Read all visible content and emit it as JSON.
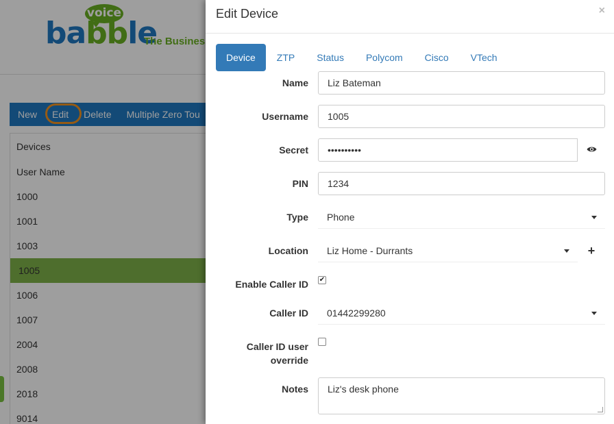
{
  "background": {
    "logo": {
      "bubble": "voice",
      "word_part1": "ba",
      "word_part2": "bb",
      "word_part3": "le",
      "tagline": "The Business"
    },
    "toolbar": {
      "new": "New",
      "edit": "Edit",
      "delete": "Delete",
      "multiple": "Multiple Zero Tou"
    },
    "panel": {
      "title": "Devices",
      "column": "User Name",
      "rows": [
        "1000",
        "1001",
        "1003",
        "1005",
        "1006",
        "1007",
        "2004",
        "2008",
        "2018",
        "9014"
      ],
      "selected_row": "1005"
    }
  },
  "modal": {
    "title": "Edit Device",
    "close": "×",
    "tabs": [
      "Device",
      "ZTP",
      "Status",
      "Polycom",
      "Cisco",
      "VTech"
    ],
    "active_tab": "Device",
    "fields": {
      "name": {
        "label": "Name",
        "value": "Liz Bateman"
      },
      "username": {
        "label": "Username",
        "value": "1005"
      },
      "secret": {
        "label": "Secret",
        "value": "••••••••••",
        "icon": "eye-icon"
      },
      "pin": {
        "label": "PIN",
        "value": "1234"
      },
      "type": {
        "label": "Type",
        "value": "Phone"
      },
      "location": {
        "label": "Location",
        "value": "Liz Home - Durrants",
        "add": "+"
      },
      "enable_caller_id": {
        "label": "Enable Caller ID",
        "checked": true,
        "mark": "✔"
      },
      "caller_id": {
        "label": "Caller ID",
        "value": "01442299280"
      },
      "caller_id_override": {
        "label_line1": "Caller ID user",
        "label_line2": "override",
        "checked": false
      },
      "notes": {
        "label": "Notes",
        "value": "Liz's desk phone"
      }
    }
  },
  "colors": {
    "primary": "#337ab7",
    "toolbar": "#1f78c1",
    "brand_green": "#6ab023",
    "selected_row": "#7fb24a",
    "highlight_ring": "#f39321"
  }
}
